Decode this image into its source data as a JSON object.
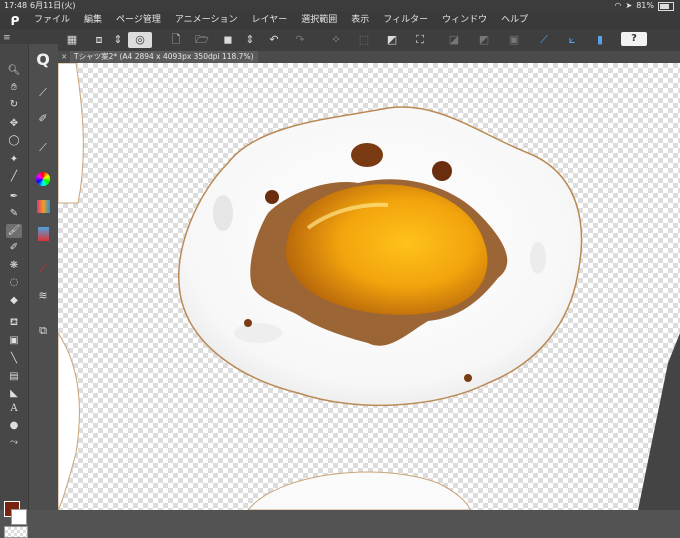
{
  "status": {
    "time": "17:48",
    "date": "6月11日(火)",
    "battery": "81%"
  },
  "menu": {
    "logo": "ᑭ",
    "items": [
      "ファイル",
      "編集",
      "ページ管理",
      "アニメーション",
      "レイヤー",
      "選択範囲",
      "表示",
      "フィルター",
      "ウィンドウ",
      "ヘルプ"
    ]
  },
  "toolbar": {
    "help": "?"
  },
  "document": {
    "tab_title": "Tシャツ案2* (A4 2894 x 4093px 350dpi 118.7%)",
    "close": "×"
  },
  "colors": {
    "main": "#7a2210",
    "sub": "#ffffff",
    "accent": "#5aa0e6"
  },
  "tools": [
    "zoom-icon",
    "hand-icon",
    "rotate-icon",
    "move-icon",
    "lasso-icon",
    "wand-icon",
    "eyedropper-icon",
    "pen-icon",
    "pencil-icon",
    "brush-icon",
    "airbrush-icon",
    "decoration-icon",
    "blend-icon",
    "eraser-icon",
    "fill-icon",
    "gradient-icon",
    "line-icon",
    "ruler-icon",
    "text-icon",
    "balloon-icon",
    "correct-line-icon"
  ],
  "subtools": [
    "q-icon",
    "pen-sub-icon",
    "marker-sub-icon",
    "ink-sub-icon",
    "color-wheel-icon",
    "color-set-icon",
    "layer-icon",
    "swatch-icon",
    "ruler-sub-icon",
    "material-icon"
  ]
}
